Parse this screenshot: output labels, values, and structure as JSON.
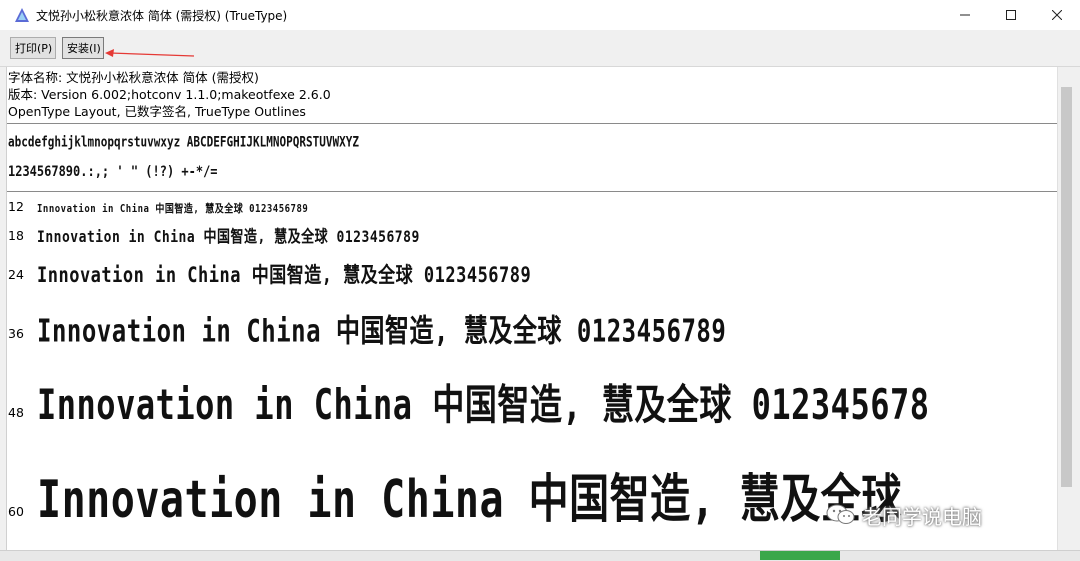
{
  "window": {
    "title": "文悦孙小松秋意浓体 简体 (需授权) (TrueType)",
    "app_icon": "font-viewer-icon"
  },
  "toolbar": {
    "print_label": "打印(P)",
    "install_label": "安装(I)"
  },
  "font_info": {
    "name_line": "字体名称: 文悦孙小松秋意浓体 简体 (需授权)",
    "version_line": "版本: Version 6.002;hotconv 1.1.0;makeotfexe 2.6.0",
    "features_line": "OpenType Layout, 已数字签名, TrueType Outlines"
  },
  "charset": {
    "letters": "abcdefghijklmnopqrstuvwxyz ABCDEFGHIJKLMNOPQRSTUVWXYZ",
    "digits": "1234567890.:,; ' \" (!?) +-*/="
  },
  "samples": [
    {
      "size": "12",
      "text": "Innovation in China 中国智造, 慧及全球 0123456789"
    },
    {
      "size": "18",
      "text": "Innovation in China 中国智造, 慧及全球 0123456789"
    },
    {
      "size": "24",
      "text": "Innovation in China 中国智造, 慧及全球 0123456789"
    },
    {
      "size": "36",
      "text": "Innovation in China 中国智造, 慧及全球 0123456789"
    },
    {
      "size": "48",
      "text": "Innovation in China 中国智造, 慧及全球 012345678"
    },
    {
      "size": "60",
      "text": "Innovation in China 中国智造, 慧及全球"
    }
  ],
  "watermark": {
    "text": "老同学说电脑",
    "icon": "wechat-icon"
  },
  "colors": {
    "annotation_arrow": "#e53935",
    "titlebar_bg": "#ffffff",
    "content_bg": "#ffffff"
  }
}
